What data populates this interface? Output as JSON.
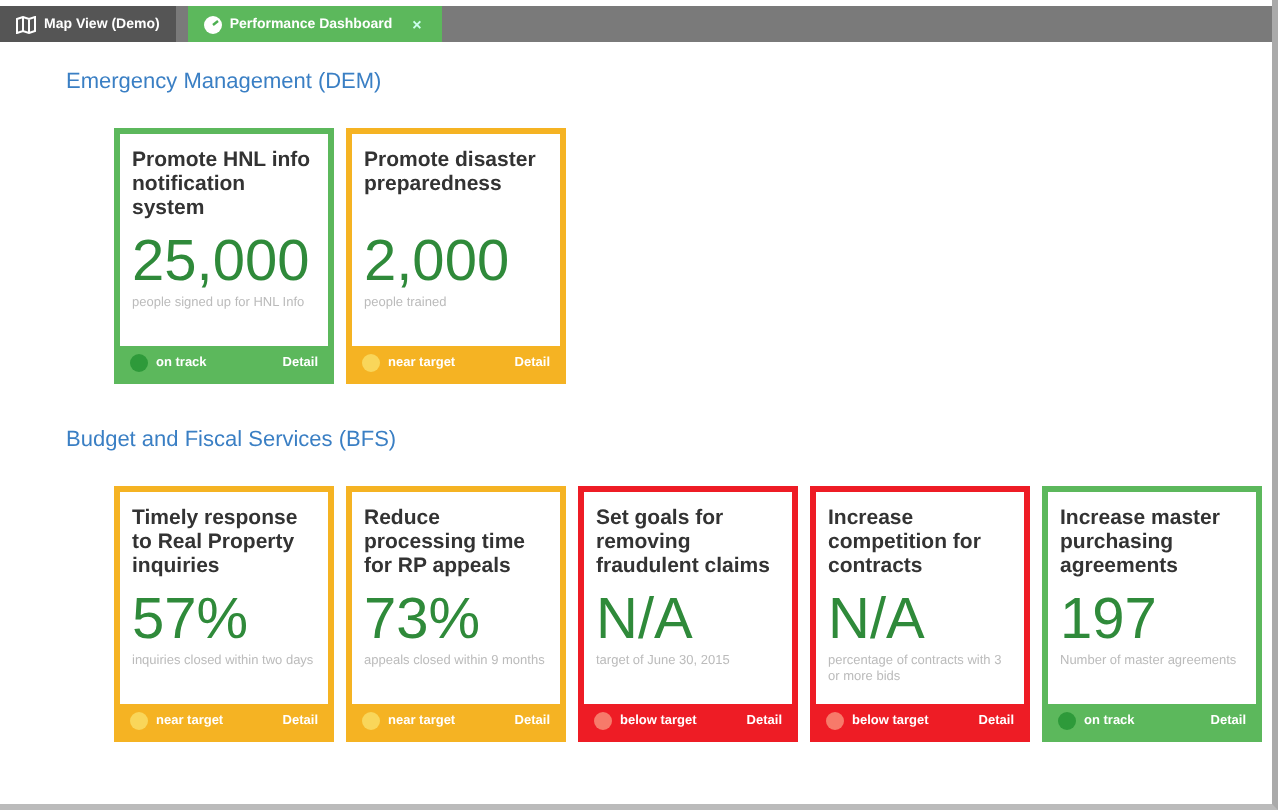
{
  "tabs": [
    {
      "label": "Map View (Demo)",
      "selected": false
    },
    {
      "label": "Performance Dashboard",
      "selected": true,
      "close": "×"
    }
  ],
  "sections": [
    {
      "title": "Emergency Management (DEM)",
      "cards": [
        {
          "title": "Promote HNL info notification system",
          "value": "25,000",
          "caption": "people signed up for HNL Info",
          "kind": "on-track",
          "status": "on track",
          "link": "Detail"
        },
        {
          "title": "Promote disaster preparedness",
          "value": "2,000",
          "caption": "people trained",
          "kind": "near-target",
          "status": "near target",
          "link": "Detail"
        }
      ]
    },
    {
      "title": "Budget and Fiscal Services (BFS)",
      "cards": [
        {
          "title": "Timely response to Real Property inquiries",
          "value": "57%",
          "caption": "inquiries closed within two days",
          "kind": "near-target",
          "status": "near target",
          "link": "Detail"
        },
        {
          "title": "Reduce processing time for RP appeals",
          "value": "73%",
          "caption": "appeals closed within 9 months",
          "kind": "near-target",
          "status": "near target",
          "link": "Detail"
        },
        {
          "title": "Set goals for removing fraudulent claims",
          "value": "N/A",
          "caption": "target of June 30, 2015",
          "kind": "below-target",
          "status": "below target",
          "link": "Detail"
        },
        {
          "title": "Increase competition for contracts",
          "value": "N/A",
          "caption": "percentage of contracts with 3 or more bids",
          "kind": "below-target",
          "status": "below target",
          "link": "Detail"
        },
        {
          "title": "Increase master purchasing agreements",
          "value": "197",
          "caption": "Number of master agreements",
          "kind": "on-track",
          "status": "on track",
          "link": "Detail"
        }
      ]
    }
  ]
}
